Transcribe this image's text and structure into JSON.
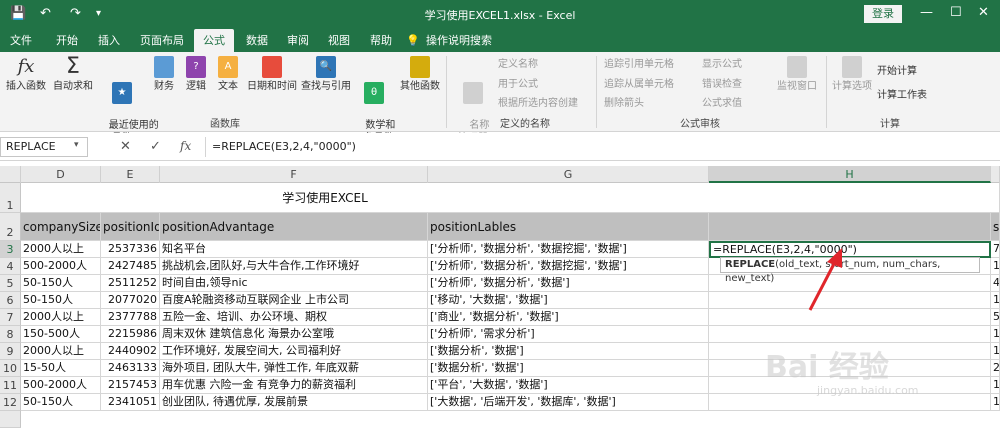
{
  "window": {
    "title": "学习使用EXCEL1.xlsx  -  Excel",
    "login_label": "登录",
    "minimize": "—",
    "restore": "☐",
    "close": "✕"
  },
  "tabs": [
    "文件",
    "开始",
    "插入",
    "页面布局",
    "公式",
    "数据",
    "审阅",
    "视图",
    "帮助",
    "操作说明搜索"
  ],
  "ribbon": {
    "lib_buttons": [
      "插入函数",
      "自动求和",
      "最近使用的\n函数",
      "财务",
      "逻辑",
      "文本",
      "日期和时间",
      "查找与引用",
      "数学和\n三角函数",
      "其他函数"
    ],
    "lib_label": "函数库",
    "names_button": "名称\n管理器",
    "names_items": [
      "定义名称",
      "用于公式",
      "根据所选内容创建"
    ],
    "names_label": "定义的名称",
    "audit_items": [
      "追踪引用单元格",
      "追踪从属单元格",
      "删除箭头",
      "显示公式",
      "错误检查",
      "公式求值"
    ],
    "watch_button": "监视窗口",
    "audit_label": "公式审核",
    "calc_button": "计算选项",
    "calc_items": [
      "开始计算",
      "计算工作表"
    ],
    "calc_label": "计算"
  },
  "formula_bar": {
    "name_box": "REPLACE",
    "cancel": "✕",
    "enter": "✓",
    "fx": "fx",
    "formula": "=REPLACE(E3,2,4,\"0000\")"
  },
  "columns": [
    "D",
    "E",
    "F",
    "G",
    "H"
  ],
  "sheet": {
    "title": "学习使用EXCEL",
    "headers": [
      "companySize",
      "positionId",
      "positionAdvantage",
      "positionLables",
      "",
      "sa"
    ],
    "rows": [
      {
        "n": "3",
        "d": "2000人以上",
        "e": "2537336",
        "f": "知名平台",
        "g": "['分析师', '数据分析', '数据挖掘', '数据']",
        "h": "=REPLACE(E3,2,4,\"0000\")",
        "i": "7"
      },
      {
        "n": "4",
        "d": "500-2000人",
        "e": "2427485",
        "f": "挑战机会,团队好,与大牛合作,工作环境好",
        "g": "['分析师', '数据分析', '数据挖掘', '数据']",
        "h": "",
        "i": "1"
      },
      {
        "n": "5",
        "d": "50-150人",
        "e": "2511252",
        "f": "时间自由,领导nic",
        "g": "['分析师', '数据分析', '数据']",
        "h": "",
        "i": "4"
      },
      {
        "n": "6",
        "d": "50-150人",
        "e": "2077020",
        "f": "百度A轮融资移动互联网企业 上市公司",
        "g": "['移动', '大数据', '数据']",
        "h": "",
        "i": "1"
      },
      {
        "n": "7",
        "d": "2000人以上",
        "e": "2377788",
        "f": "五险一金、培训、办公环境、期权",
        "g": "['商业', '数据分析', '数据']",
        "h": "",
        "i": "5"
      },
      {
        "n": "8",
        "d": "150-500人",
        "e": "2215986",
        "f": "周末双休 建筑信息化 海景办公室哦",
        "g": "['分析师', '需求分析']",
        "h": "",
        "i": "1"
      },
      {
        "n": "9",
        "d": "2000人以上",
        "e": "2440902",
        "f": "工作环境好, 发展空间大, 公司福利好",
        "g": "['数据分析', '数据']",
        "h": "",
        "i": "1"
      },
      {
        "n": "10",
        "d": "15-50人",
        "e": "2463133",
        "f": "海外项目, 团队大牛, 弹性工作, 年底双薪",
        "g": "['数据分析', '数据']",
        "h": "",
        "i": "2"
      },
      {
        "n": "11",
        "d": "500-2000人",
        "e": "2157453",
        "f": "用车优惠 六险一金 有竞争力的薪资福利",
        "g": "['平台', '大数据', '数据']",
        "h": "",
        "i": "1"
      },
      {
        "n": "12",
        "d": "50-150人",
        "e": "2341051",
        "f": "创业团队, 待遇优厚, 发展前景",
        "g": "['大数据', '后端开发', '数据库', '数据']",
        "h": "",
        "i": "1"
      }
    ]
  },
  "tooltip": {
    "fn": "REPLACE",
    "args": "(old_text, start_num, num_chars, new_text)"
  },
  "watermark": {
    "main": "Bai 经验",
    "sub": "jingyan.baidu.com"
  },
  "colors": {
    "excel_green": "#217346",
    "arrow_red": "#e0262b"
  }
}
